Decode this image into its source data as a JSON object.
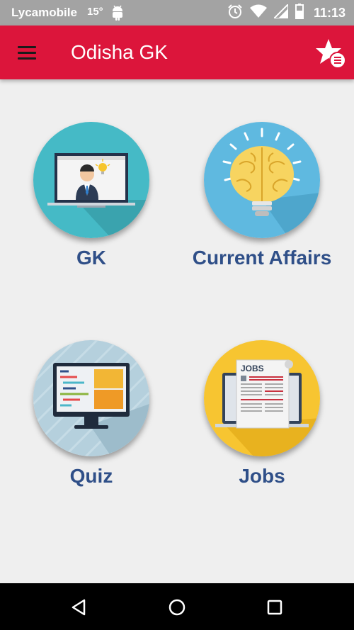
{
  "status_bar": {
    "carrier": "Lycamobile",
    "temperature": "15°",
    "time": "11:13",
    "icons": [
      "android-debug-icon",
      "alarm-icon",
      "wifi-icon",
      "signal-icon",
      "battery-icon"
    ]
  },
  "app_bar": {
    "title": "Odisha GK",
    "color": "#dc153b",
    "menu_icon": "hamburger-menu-icon",
    "favorites_icon": "star-list-icon"
  },
  "tiles": [
    {
      "label": "GK",
      "icon": "presenter-laptop-icon",
      "color": "#45bac6"
    },
    {
      "label": "Current Affairs",
      "icon": "brain-lightbulb-icon",
      "color": "#5fb9e0"
    },
    {
      "label": "Quiz",
      "icon": "code-monitor-icon",
      "color": "#b5d0dd"
    },
    {
      "label": "Jobs",
      "icon": "jobs-newspaper-icon",
      "color": "#f7c531"
    }
  ],
  "nav_bar": {
    "buttons": [
      "back-icon",
      "home-icon",
      "recents-icon"
    ]
  }
}
